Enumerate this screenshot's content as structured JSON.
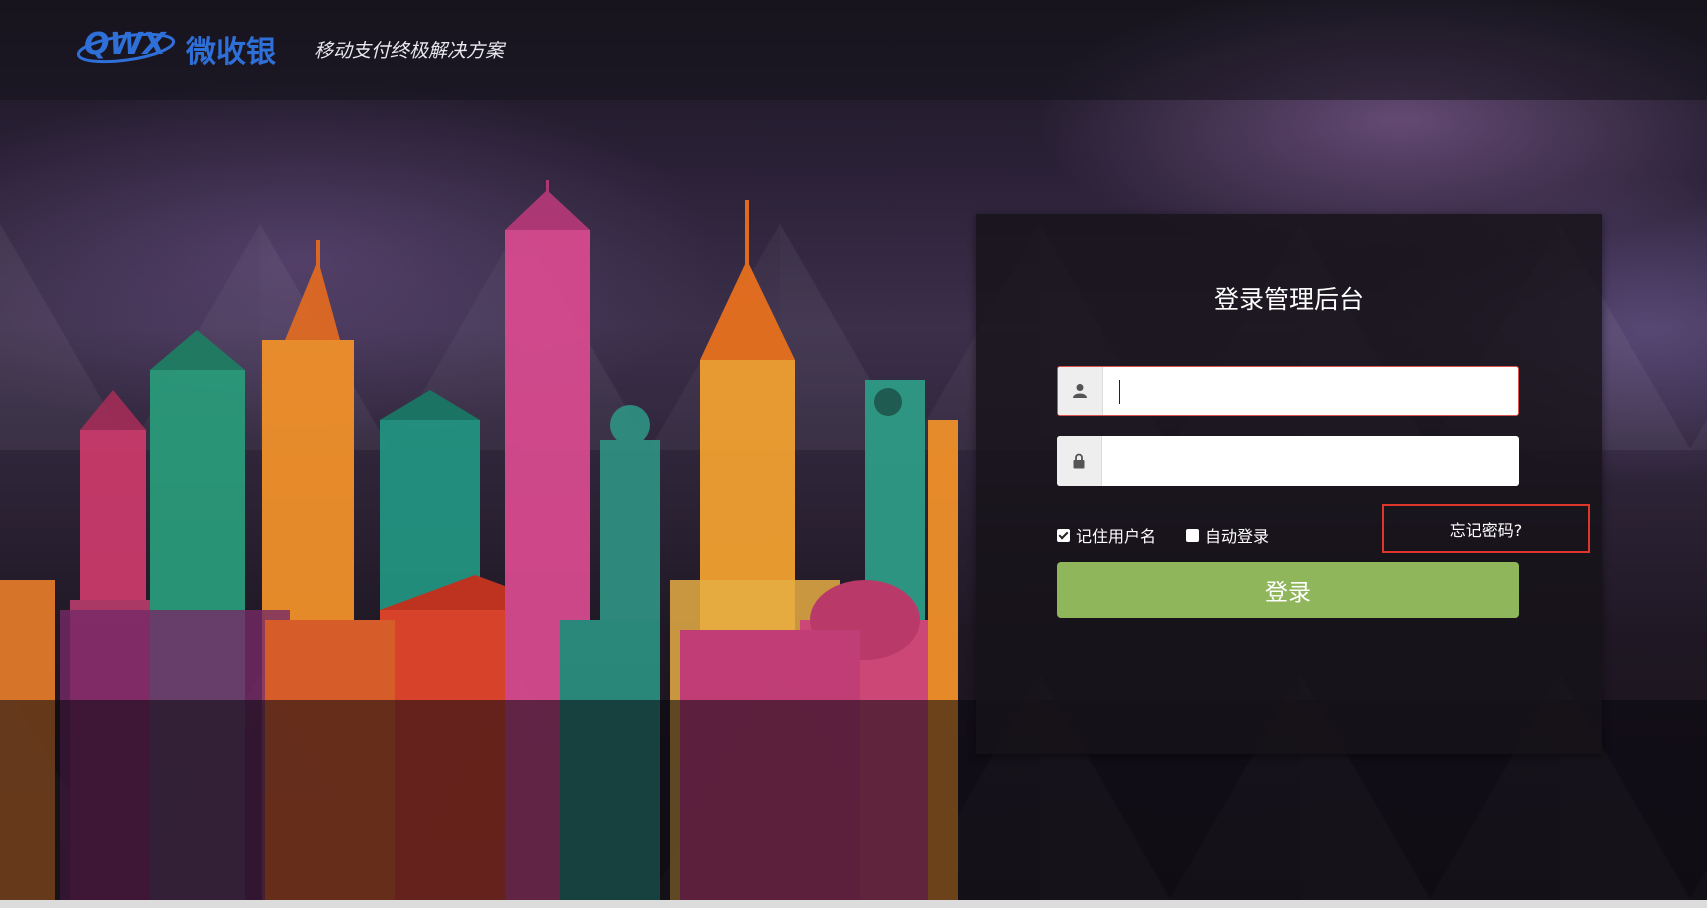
{
  "header": {
    "logo_text": "QWX",
    "logo_brand": "微收银",
    "slogan": "移动支付终极解决方案"
  },
  "login": {
    "title": "登录管理后台",
    "username": {
      "value": "",
      "placeholder": ""
    },
    "password": {
      "value": "",
      "placeholder": ""
    },
    "remember_label": "记住用户名",
    "remember_checked": true,
    "auto_label": "自动登录",
    "auto_checked": false,
    "forgot_label": "忘记密码?",
    "submit_label": "登录"
  },
  "icons": {
    "username": "user-icon",
    "password": "lock-icon"
  },
  "colors": {
    "brand_blue": "#2f6fd8",
    "button_green": "#8fb65a",
    "highlight_red": "#e0352b"
  }
}
